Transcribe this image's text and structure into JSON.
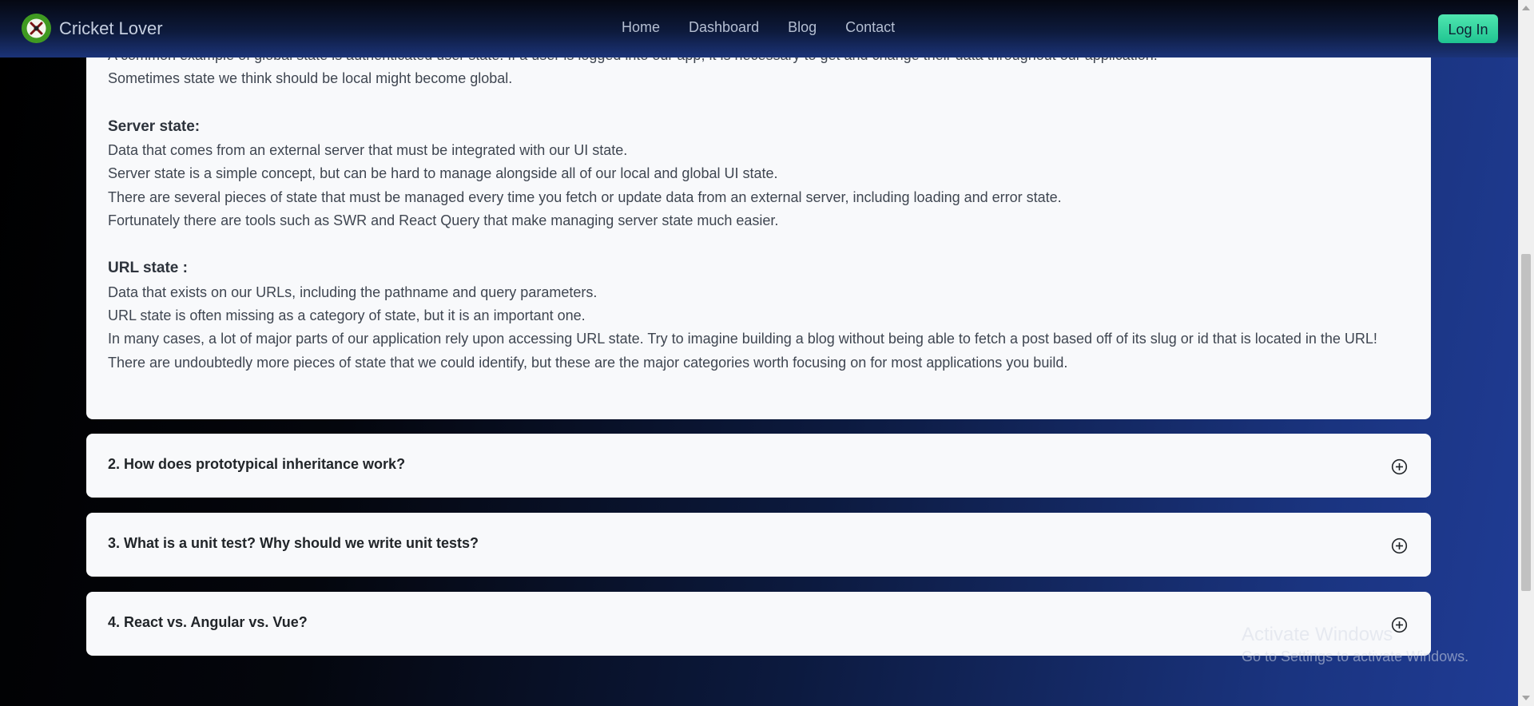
{
  "navbar": {
    "brand": "Cricket Lover",
    "links": [
      "Home",
      "Dashboard",
      "Blog",
      "Contact"
    ],
    "login": "Log In"
  },
  "answer": {
    "lines": [
      "A common example of global state is authenticated user state. If a user is logged into our app, it is necessary to get and change their data throughout our application.",
      "Sometimes state we think should be local might become global.",
      "Server state:",
      "Data that comes from an external server that must be integrated with our UI state.",
      "Server state is a simple concept, but can be hard to manage alongside all of our local and global UI state.",
      "There are several pieces of state that must be managed every time you fetch or update data from an external server, including loading and error state.",
      "Fortunately there are tools such as SWR and React Query that make managing server state much easier.",
      "URL state :",
      "Data that exists on our URLs, including the pathname and query parameters.",
      "URL state is often missing as a category of state, but it is an important one.",
      "In many cases, a lot of major parts of our application rely upon accessing URL state. Try to imagine building a blog without being able to fetch a post based off of its slug or id that is located in the URL!",
      "There are undoubtedly more pieces of state that we could identify, but these are the major categories worth focusing on for most applications you build."
    ]
  },
  "faqs": [
    {
      "title": "2. How does prototypical inheritance work?",
      "icon": "plus-circle-icon"
    },
    {
      "title": "3. What is a unit test? Why should we write unit tests?",
      "icon": "plus-circle-icon"
    },
    {
      "title": "4. React vs. Angular vs. Vue?",
      "icon": "plus-circle-icon"
    }
  ],
  "watermark": {
    "title": "Activate Windows",
    "subtitle": "Go to Settings to activate Windows."
  }
}
